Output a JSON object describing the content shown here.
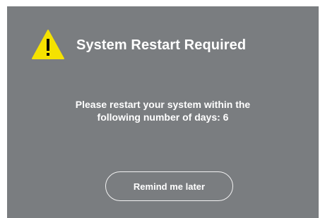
{
  "dialog": {
    "title": "System Restart Required",
    "icon": "warning-triangle-icon",
    "message_line1": "Please restart your system within the",
    "message_line2": "following number of days: 6",
    "remind_button_label": "Remind me later"
  },
  "colors": {
    "dialog_background": "#7a7d80",
    "warning_yellow": "#f5e200",
    "text": "#ffffff"
  }
}
